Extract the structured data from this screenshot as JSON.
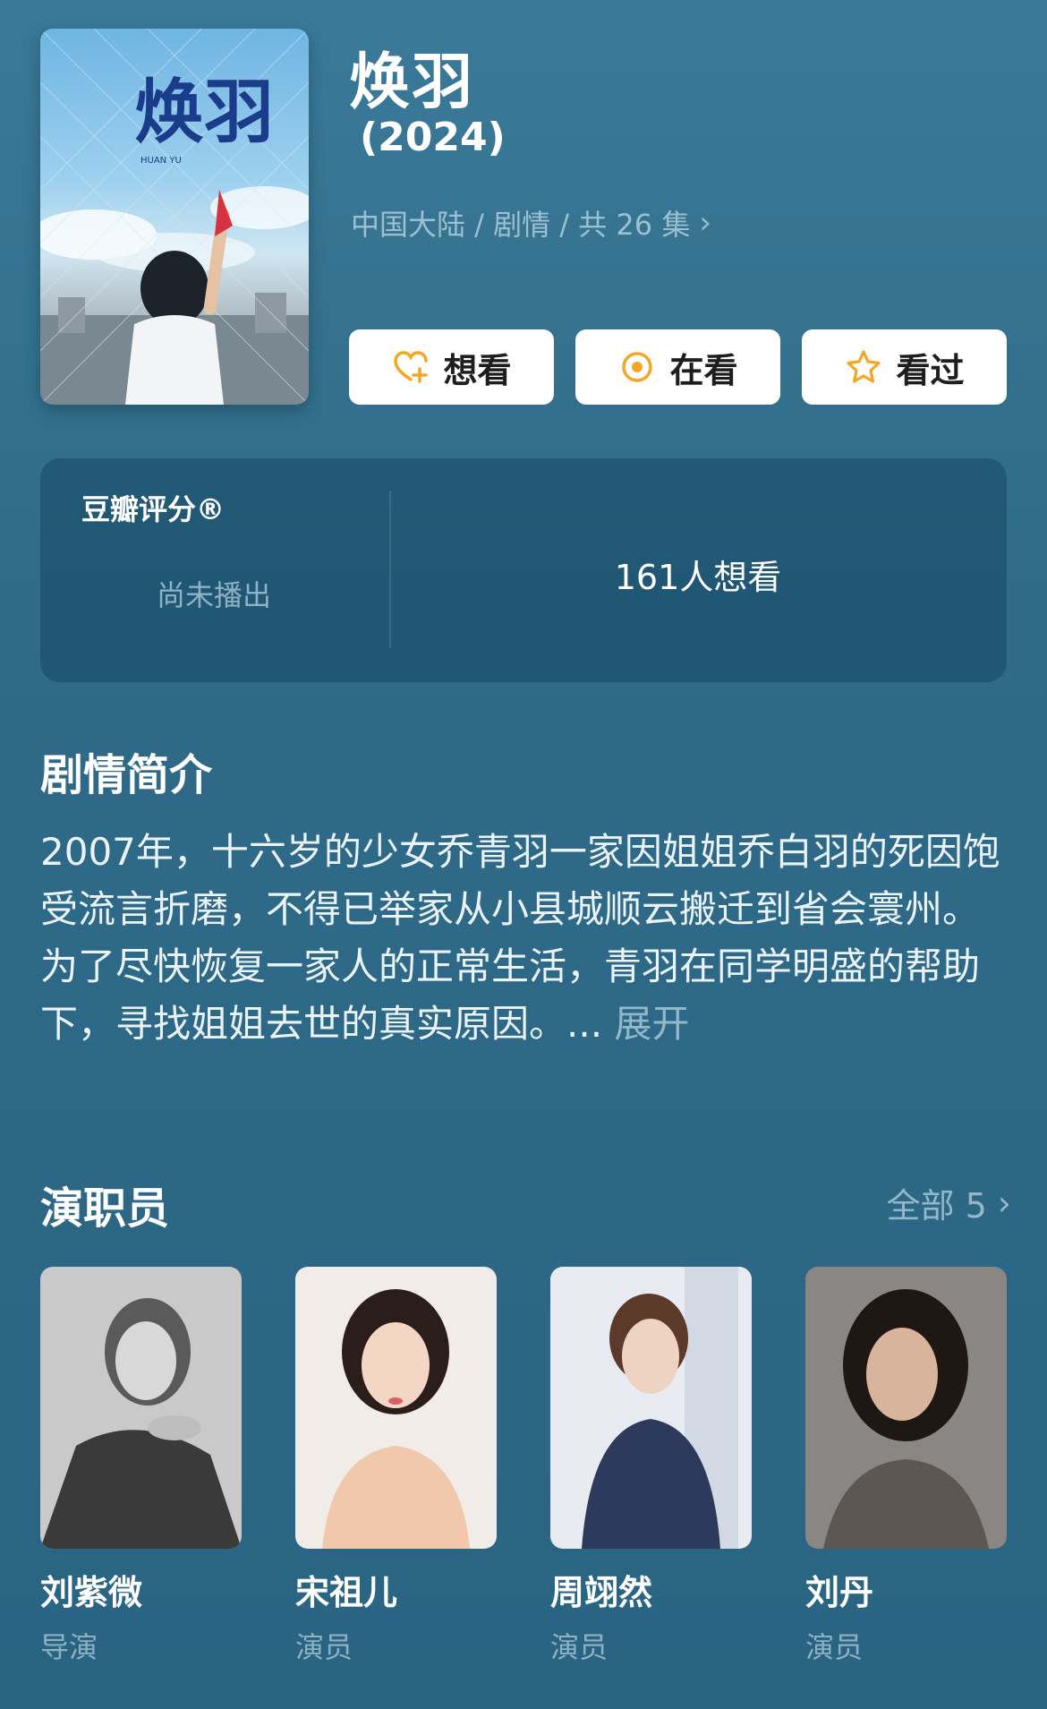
{
  "show": {
    "title": "焕羽",
    "year": "(2024)",
    "meta": "中国大陆 / 剧情 / 共 26 集",
    "poster_title": "焕羽",
    "poster_subtitle": "HUAN YU"
  },
  "actions": {
    "want_label": "想看",
    "watching_label": "在看",
    "watched_label": "看过",
    "accent_color": "#f5a623"
  },
  "rating": {
    "label": "豆瓣评分®",
    "status": "尚未播出",
    "wish_count": "161人想看"
  },
  "synopsis": {
    "heading": "剧情简介",
    "text": "2007年，十六岁的少女乔青羽一家因姐姐乔白羽的死因饱受流言折磨，不得已举家从小县城顺云搬迁到省会寰州。为了尽快恢复一家人的正常生活，青羽在同学明盛的帮助下，寻找姐姐去世的真实原因。...",
    "more_label": "展开"
  },
  "cast": {
    "heading": "演职员",
    "see_all": "全部 5",
    "members": [
      {
        "name": "刘紫微",
        "role": "导演"
      },
      {
        "name": "宋祖儿",
        "role": "演员"
      },
      {
        "name": "周翊然",
        "role": "演员"
      },
      {
        "name": "刘丹",
        "role": "演员"
      }
    ]
  }
}
